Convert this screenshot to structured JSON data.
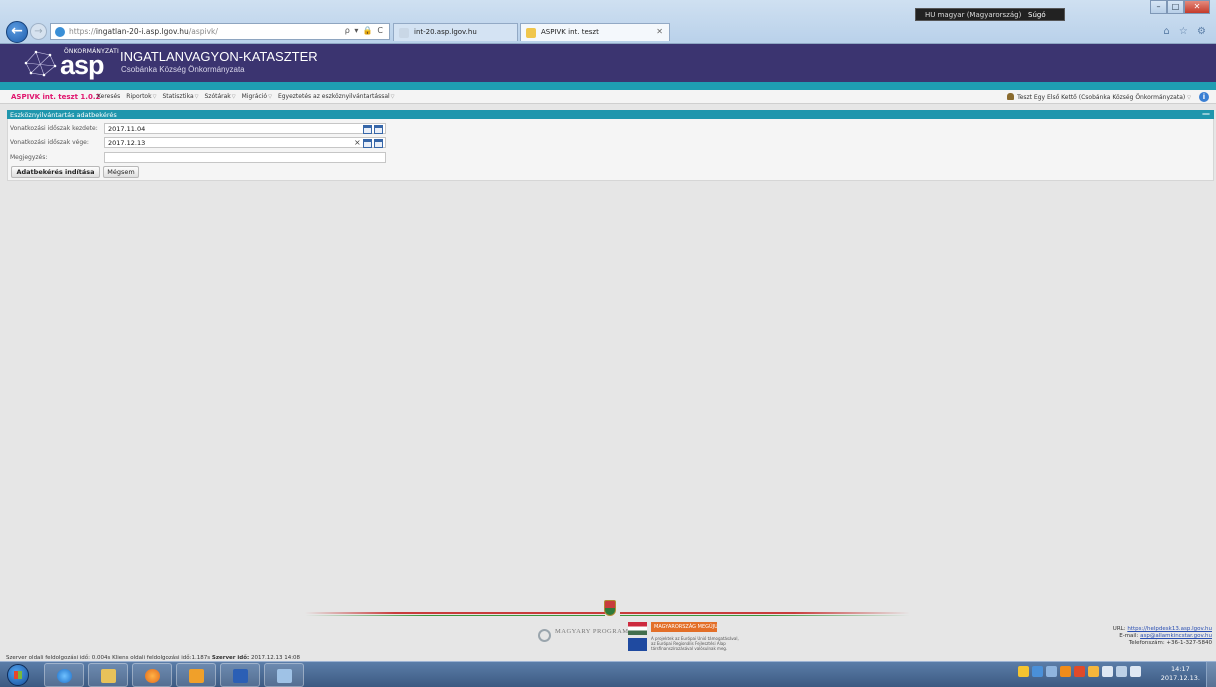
{
  "browser": {
    "url_prefix": "https://",
    "url_domain": "ingatlan-20-i.asp.lgov.hu",
    "url_path": "/aspivk/",
    "addr_tools": "ρ ▾ 🔒 C",
    "tabs": [
      {
        "label": "int-20.asp.lgov.hu"
      },
      {
        "label": "ASPIVK int. teszt"
      }
    ],
    "tab_close": "✕",
    "language": "HU magyar (Magyarország)",
    "help_label": "Súgó",
    "back_glyph": "←",
    "fwd_glyph": "→",
    "fav_icons": "⌂ ☆ ⚙"
  },
  "app": {
    "logo_small": "ÖNKORMÁNYZATI",
    "logo_main": "asp",
    "title": "INGATLANVAGYON-KATASZTER",
    "subtitle": "Csobánka Község Önkormányzata"
  },
  "nav": {
    "app_version": "ASPIVK int. teszt 1.0.2",
    "items": [
      {
        "label": "Keresés",
        "has_menu": false
      },
      {
        "label": "Riportok",
        "has_menu": true
      },
      {
        "label": "Statisztika",
        "has_menu": true
      },
      {
        "label": "Szótárak",
        "has_menu": true
      },
      {
        "label": "Migráció",
        "has_menu": true
      },
      {
        "label": "Egyeztetés az eszköznyilvántartással",
        "has_menu": true
      }
    ],
    "menu_arrow": "▽",
    "user": "Teszt Egy Első Kettő (Csobánka Község Önkormányzata)",
    "user_arrow": "▽",
    "info": "i"
  },
  "panel": {
    "title": "Eszköznyilvántartás adatbekérés",
    "collapse": "—",
    "fields": {
      "start_label": "Vonatkozási időszak kezdete:",
      "start_value": "2017.11.04",
      "end_label": "Vonatkozási időszak vége:",
      "end_value": "2017.12.13",
      "note_label": "Megjegyzés:",
      "note_value": ""
    },
    "clear": "×",
    "buttons": {
      "submit": "Adatbekérés indítása",
      "cancel": "Mégsem"
    }
  },
  "footer": {
    "magyary": "MAGYARY PROGRAM",
    "hsz": "MAGYARORSZÁG MEGÚJUL",
    "eu_text": "A projektek az Európai Unió támogatásával, az Európai Regionális Fejlesztési Alap társfinanszírozásával valósulnak meg.",
    "url_label": "URL:",
    "url_value": "https://helpdesk13.asp.lgov.hu",
    "email_label": "E-mail:",
    "email_value": "asp@allamkincstar.gov.hu",
    "phone": "Telefonszám: +36-1-327-5840",
    "status_client": "Szerver oldali feldolgozási idő: 0.004s Kliens oldali feldolgozási idő:1.187s",
    "status_server_label": "Szerver idő:",
    "status_server_time": "2017.12.13 14:08"
  },
  "taskbar": {
    "clock_time": "14:17",
    "clock_date": "2017.12.13."
  }
}
